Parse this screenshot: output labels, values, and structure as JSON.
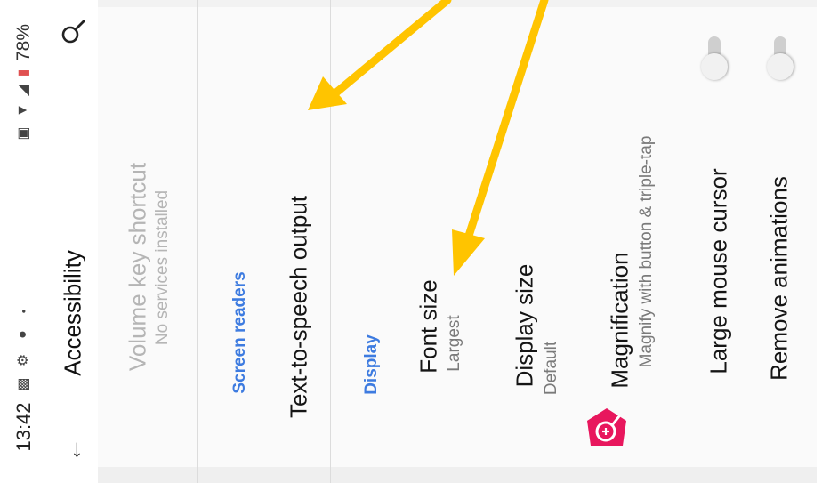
{
  "status_bar": {
    "time": "13:42",
    "battery": "78%",
    "icons": [
      "notification-icon",
      "settings-gear-icon",
      "cloud-icon",
      "dot-icon",
      "nfc-icon",
      "wifi-icon",
      "signal-icon",
      "battery-icon"
    ]
  },
  "app_bar": {
    "title": "Accessibility",
    "back_icon": "arrow-back-icon",
    "search_icon": "search-icon"
  },
  "items": {
    "volume_shortcut": {
      "title": "Volume key shortcut",
      "subtitle": "No services installed",
      "enabled": false
    },
    "screen_readers_header": "Screen readers",
    "tts": {
      "title": "Text-to-speech output"
    },
    "display_header": "Display",
    "font_size": {
      "title": "Font size",
      "subtitle": "Largest"
    },
    "display_size": {
      "title": "Display size",
      "subtitle": "Default"
    },
    "magnification": {
      "title": "Magnification",
      "subtitle": "Magnify with button & triple-tap",
      "icon": "magnification-icon"
    },
    "large_cursor": {
      "title": "Large mouse cursor",
      "toggle": "off"
    },
    "remove_animations": {
      "title": "Remove animations",
      "toggle": "off"
    }
  },
  "colors": {
    "accent": "#3d7be0",
    "annotation_arrow": "#ffc400",
    "magnification_icon": "#e8175d"
  }
}
